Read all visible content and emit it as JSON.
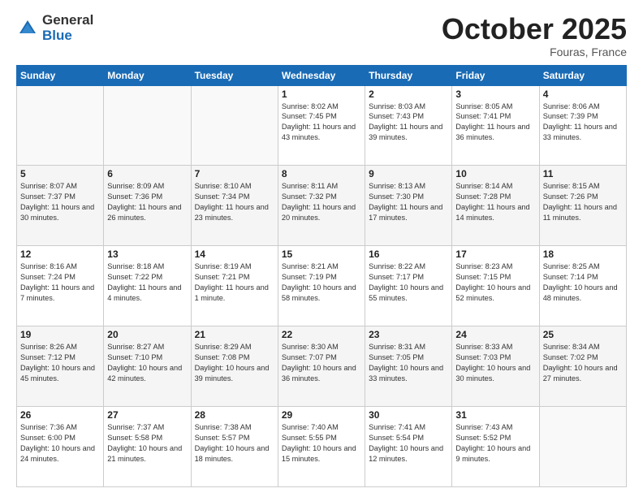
{
  "logo": {
    "general": "General",
    "blue": "Blue"
  },
  "title": "October 2025",
  "location": "Fouras, France",
  "days_header": [
    "Sunday",
    "Monday",
    "Tuesday",
    "Wednesday",
    "Thursday",
    "Friday",
    "Saturday"
  ],
  "weeks": [
    [
      {
        "day": "",
        "text": ""
      },
      {
        "day": "",
        "text": ""
      },
      {
        "day": "",
        "text": ""
      },
      {
        "day": "1",
        "text": "Sunrise: 8:02 AM\nSunset: 7:45 PM\nDaylight: 11 hours\nand 43 minutes."
      },
      {
        "day": "2",
        "text": "Sunrise: 8:03 AM\nSunset: 7:43 PM\nDaylight: 11 hours\nand 39 minutes."
      },
      {
        "day": "3",
        "text": "Sunrise: 8:05 AM\nSunset: 7:41 PM\nDaylight: 11 hours\nand 36 minutes."
      },
      {
        "day": "4",
        "text": "Sunrise: 8:06 AM\nSunset: 7:39 PM\nDaylight: 11 hours\nand 33 minutes."
      }
    ],
    [
      {
        "day": "5",
        "text": "Sunrise: 8:07 AM\nSunset: 7:37 PM\nDaylight: 11 hours\nand 30 minutes."
      },
      {
        "day": "6",
        "text": "Sunrise: 8:09 AM\nSunset: 7:36 PM\nDaylight: 11 hours\nand 26 minutes."
      },
      {
        "day": "7",
        "text": "Sunrise: 8:10 AM\nSunset: 7:34 PM\nDaylight: 11 hours\nand 23 minutes."
      },
      {
        "day": "8",
        "text": "Sunrise: 8:11 AM\nSunset: 7:32 PM\nDaylight: 11 hours\nand 20 minutes."
      },
      {
        "day": "9",
        "text": "Sunrise: 8:13 AM\nSunset: 7:30 PM\nDaylight: 11 hours\nand 17 minutes."
      },
      {
        "day": "10",
        "text": "Sunrise: 8:14 AM\nSunset: 7:28 PM\nDaylight: 11 hours\nand 14 minutes."
      },
      {
        "day": "11",
        "text": "Sunrise: 8:15 AM\nSunset: 7:26 PM\nDaylight: 11 hours\nand 11 minutes."
      }
    ],
    [
      {
        "day": "12",
        "text": "Sunrise: 8:16 AM\nSunset: 7:24 PM\nDaylight: 11 hours\nand 7 minutes."
      },
      {
        "day": "13",
        "text": "Sunrise: 8:18 AM\nSunset: 7:22 PM\nDaylight: 11 hours\nand 4 minutes."
      },
      {
        "day": "14",
        "text": "Sunrise: 8:19 AM\nSunset: 7:21 PM\nDaylight: 11 hours\nand 1 minute."
      },
      {
        "day": "15",
        "text": "Sunrise: 8:21 AM\nSunset: 7:19 PM\nDaylight: 10 hours\nand 58 minutes."
      },
      {
        "day": "16",
        "text": "Sunrise: 8:22 AM\nSunset: 7:17 PM\nDaylight: 10 hours\nand 55 minutes."
      },
      {
        "day": "17",
        "text": "Sunrise: 8:23 AM\nSunset: 7:15 PM\nDaylight: 10 hours\nand 52 minutes."
      },
      {
        "day": "18",
        "text": "Sunrise: 8:25 AM\nSunset: 7:14 PM\nDaylight: 10 hours\nand 48 minutes."
      }
    ],
    [
      {
        "day": "19",
        "text": "Sunrise: 8:26 AM\nSunset: 7:12 PM\nDaylight: 10 hours\nand 45 minutes."
      },
      {
        "day": "20",
        "text": "Sunrise: 8:27 AM\nSunset: 7:10 PM\nDaylight: 10 hours\nand 42 minutes."
      },
      {
        "day": "21",
        "text": "Sunrise: 8:29 AM\nSunset: 7:08 PM\nDaylight: 10 hours\nand 39 minutes."
      },
      {
        "day": "22",
        "text": "Sunrise: 8:30 AM\nSunset: 7:07 PM\nDaylight: 10 hours\nand 36 minutes."
      },
      {
        "day": "23",
        "text": "Sunrise: 8:31 AM\nSunset: 7:05 PM\nDaylight: 10 hours\nand 33 minutes."
      },
      {
        "day": "24",
        "text": "Sunrise: 8:33 AM\nSunset: 7:03 PM\nDaylight: 10 hours\nand 30 minutes."
      },
      {
        "day": "25",
        "text": "Sunrise: 8:34 AM\nSunset: 7:02 PM\nDaylight: 10 hours\nand 27 minutes."
      }
    ],
    [
      {
        "day": "26",
        "text": "Sunrise: 7:36 AM\nSunset: 6:00 PM\nDaylight: 10 hours\nand 24 minutes."
      },
      {
        "day": "27",
        "text": "Sunrise: 7:37 AM\nSunset: 5:58 PM\nDaylight: 10 hours\nand 21 minutes."
      },
      {
        "day": "28",
        "text": "Sunrise: 7:38 AM\nSunset: 5:57 PM\nDaylight: 10 hours\nand 18 minutes."
      },
      {
        "day": "29",
        "text": "Sunrise: 7:40 AM\nSunset: 5:55 PM\nDaylight: 10 hours\nand 15 minutes."
      },
      {
        "day": "30",
        "text": "Sunrise: 7:41 AM\nSunset: 5:54 PM\nDaylight: 10 hours\nand 12 minutes."
      },
      {
        "day": "31",
        "text": "Sunrise: 7:43 AM\nSunset: 5:52 PM\nDaylight: 10 hours\nand 9 minutes."
      },
      {
        "day": "",
        "text": ""
      }
    ]
  ]
}
